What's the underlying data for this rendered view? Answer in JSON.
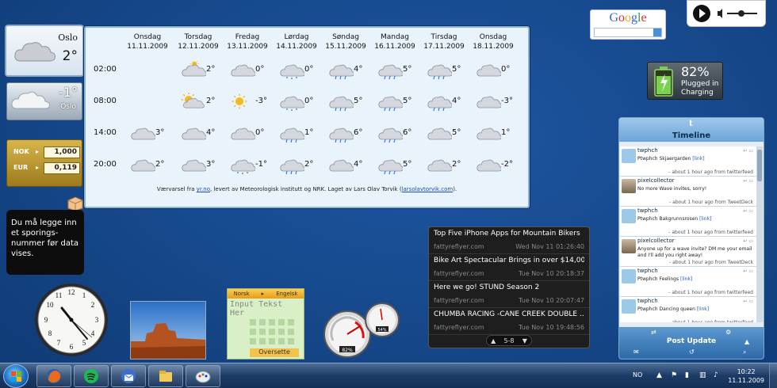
{
  "weather_small": {
    "city": "Oslo",
    "temp": "2°"
  },
  "weather_small2": {
    "city": "Oslo",
    "temp": "-1°"
  },
  "currency": {
    "rows": [
      {
        "code": "NOK",
        "value": "1,000"
      },
      {
        "code": "EUR",
        "value": "0,119"
      }
    ]
  },
  "note": {
    "text": "Du må legge inn et sporings-nummer før data vises."
  },
  "forecast": {
    "days": [
      {
        "name": "Onsdag",
        "date": "11.11.2009"
      },
      {
        "name": "Torsdag",
        "date": "12.11.2009"
      },
      {
        "name": "Fredag",
        "date": "13.11.2009"
      },
      {
        "name": "Lørdag",
        "date": "14.11.2009"
      },
      {
        "name": "Søndag",
        "date": "15.11.2009"
      },
      {
        "name": "Mandag",
        "date": "16.11.2009"
      },
      {
        "name": "Tirsdag",
        "date": "17.11.2009"
      },
      {
        "name": "Onsdag",
        "date": "18.11.2009"
      }
    ],
    "times": [
      "02:00",
      "08:00",
      "14:00",
      "20:00"
    ],
    "cells": [
      [
        null,
        {
          "icon": "cloud-sun",
          "temp": "2°"
        },
        {
          "icon": "cloud",
          "temp": "0°"
        },
        {
          "icon": "snow-cloud",
          "temp": "0°"
        },
        {
          "icon": "rain-cloud",
          "temp": "4°"
        },
        {
          "icon": "rain-cloud",
          "temp": "5°"
        },
        {
          "icon": "rain-cloud",
          "temp": "5°"
        },
        {
          "icon": "cloud",
          "temp": "0°"
        }
      ],
      [
        null,
        {
          "icon": "sun-cloud",
          "temp": "2°"
        },
        {
          "icon": "sun",
          "temp": "-3°"
        },
        {
          "icon": "snow-cloud",
          "temp": "0°"
        },
        {
          "icon": "rain-cloud",
          "temp": "5°"
        },
        {
          "icon": "rain-cloud",
          "temp": "5°"
        },
        {
          "icon": "rain-cloud",
          "temp": "4°"
        },
        {
          "icon": "cloud",
          "temp": "-3°"
        }
      ],
      [
        {
          "icon": "cloud",
          "temp": "3°"
        },
        {
          "icon": "cloud",
          "temp": "4°"
        },
        {
          "icon": "cloud",
          "temp": "0°"
        },
        {
          "icon": "rain-cloud",
          "temp": "1°"
        },
        {
          "icon": "rain-cloud",
          "temp": "6°"
        },
        {
          "icon": "rain-cloud",
          "temp": "6°"
        },
        {
          "icon": "cloud",
          "temp": "5°"
        },
        {
          "icon": "cloud",
          "temp": "1°"
        }
      ],
      [
        {
          "icon": "cloud",
          "temp": "2°"
        },
        {
          "icon": "cloud",
          "temp": "3°"
        },
        {
          "icon": "snow-cloud",
          "temp": "-1°"
        },
        {
          "icon": "rain-cloud",
          "temp": "2°"
        },
        {
          "icon": "cloud",
          "temp": "4°"
        },
        {
          "icon": "rain-cloud",
          "temp": "5°"
        },
        {
          "icon": "cloud",
          "temp": "2°"
        },
        {
          "icon": "cloud",
          "temp": "-2°"
        }
      ]
    ],
    "credit_pre": "Værvarsel fra ",
    "credit_link1": "yr.no",
    "credit_mid": ", levert av Meteorologisk institutt og NRK. Laget av Lars Olav Torvik (",
    "credit_link2": "larsolavtorvik.com",
    "credit_post": ")."
  },
  "google": {
    "logo": "Google"
  },
  "battery": {
    "percent": "82%",
    "status_line1": "Plugged in",
    "status_line2": "Charging",
    "level": 0.82
  },
  "twitter": {
    "title": "Timeline",
    "logo": "t",
    "post_update": "Post Update",
    "tweets": [
      {
        "user": "twphch",
        "text": "Ptwphch Skjaergarden",
        "link": "[link]",
        "meta": "- about 1 hour ago from twitterfeed",
        "avatar": "bird"
      },
      {
        "user": "pixelcollector",
        "text": "No more Wave invites, sorry!",
        "link": "",
        "meta": "- about 1 hour ago from TweetDeck",
        "avatar": "person"
      },
      {
        "user": "twphch",
        "text": "Ptwphch Bakgrunnsrosen",
        "link": "[link]",
        "meta": "- about 1 hour ago from twitterfeed",
        "avatar": "bird"
      },
      {
        "user": "pixelcollector",
        "text": "Anyone up for a wave invite? DM me your email and I'll add you right away!",
        "link": "",
        "meta": "- about 1 hour ago from TweetDeck",
        "avatar": "person"
      },
      {
        "user": "twphch",
        "text": "Ptwphch Feelings",
        "link": "[link]",
        "meta": "- about 1 hour ago from twitterfeed",
        "avatar": "bird"
      },
      {
        "user": "twphch",
        "text": "Ptwphch Dancing queen",
        "link": "[link]",
        "meta": "- about 1 hour ago from twitterfeed",
        "avatar": "bird"
      }
    ]
  },
  "translator": {
    "from": "Norsk",
    "to": "Engelsk",
    "placeholder": "Input Tekst Her",
    "button": "Oversette"
  },
  "cpu": {
    "cpu_label": "82%",
    "ram_label": "54%"
  },
  "feed": {
    "items": [
      {
        "title": "Top Five iPhone Apps for Mountain Bikers",
        "source": "fattyreflyer.com",
        "date": "Wed Nov 11 01:26:40"
      },
      {
        "title": "Bike Art Spectacular Brings in over $14,00...",
        "source": "fattyreflyer.com",
        "date": "Tue Nov 10 20:18:37"
      },
      {
        "title": "Here we go! STUND Season 2",
        "source": "fattyreflyer.com",
        "date": "Tue Nov 10 20:07:47"
      },
      {
        "title": "CHUMBA RACING -CANE CREEK DOUBLE ...",
        "source": "fattyreflyer.com",
        "date": "Tue Nov 10 19:48:56"
      }
    ],
    "pager": "5-8"
  },
  "taskbar": {
    "lang": "NO",
    "time": "10:22",
    "date": "11.11.2009",
    "apps": [
      "firefox-icon",
      "spotify-icon",
      "thunderbird-icon",
      "explorer-icon",
      "paint-icon"
    ]
  }
}
